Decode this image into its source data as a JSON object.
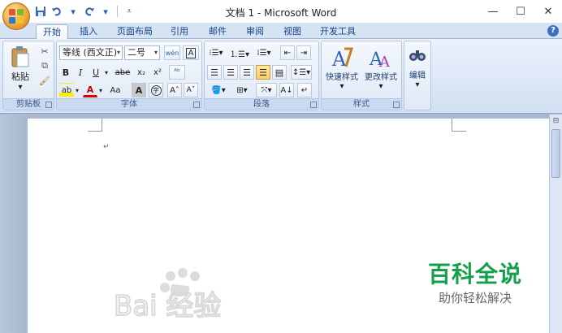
{
  "window": {
    "title": "文档 1 - Microsoft Word",
    "controls": {
      "minimize": "—",
      "maximize": "☐",
      "close": "✕"
    }
  },
  "qat": {
    "save_icon": "save-icon",
    "undo_icon": "undo-icon",
    "redo_icon": "redo-icon"
  },
  "tabs": [
    "开始",
    "插入",
    "页面布局",
    "引用",
    "邮件",
    "审阅",
    "视图",
    "开发工具"
  ],
  "ribbon": {
    "clipboard": {
      "label": "剪贴板",
      "paste": "粘贴"
    },
    "font": {
      "label": "字体",
      "font_name": "等线 (西文正)",
      "font_size": "二号",
      "bold": "B",
      "italic": "I",
      "underline": "U",
      "strike": "abe",
      "subscript": "x₂",
      "superscript": "x²",
      "change_case": "Aa",
      "char_shading": "A",
      "enclose": "字",
      "grow": "A˄",
      "shrink": "A˅",
      "font_color": "A",
      "highlight": "ab"
    },
    "paragraph": {
      "label": "段落"
    },
    "styles": {
      "label": "样式",
      "quick_styles": "快速样式",
      "change_styles": "更改样式"
    },
    "editing": {
      "label": "编辑"
    }
  },
  "document": {
    "paragraph_mark": "↵"
  },
  "watermark": {
    "title": "百科全说",
    "subtitle": "助你轻松解决",
    "logo_text": "Bai 经验"
  },
  "colors": {
    "accent": "#15428b",
    "watermark_green": "#12a04a"
  }
}
